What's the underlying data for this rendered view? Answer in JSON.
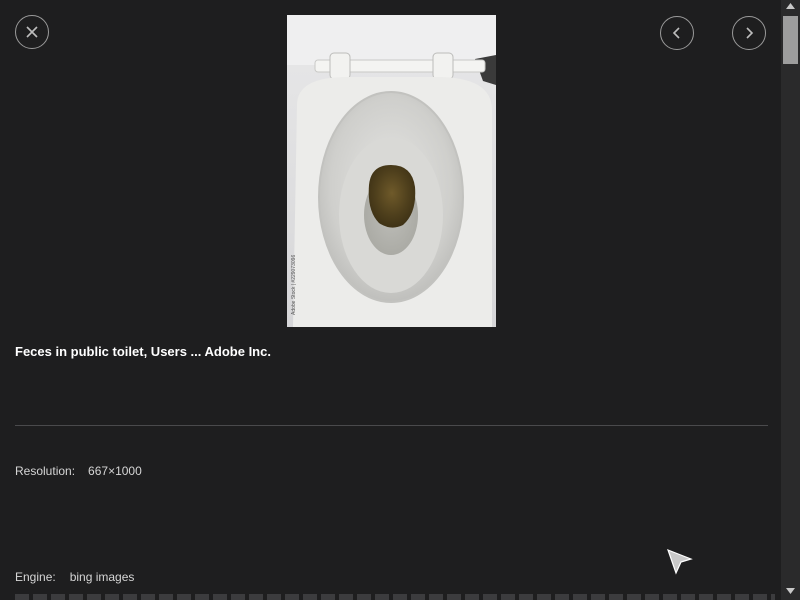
{
  "viewer": {
    "title": "Feces in public toilet, Users ... Adobe Inc.",
    "resolution_label": "Resolution:",
    "resolution_value": "667×1000",
    "engine_label": "Engine:",
    "engine_value": "bing images"
  },
  "image": {
    "alt": "toilet bowl viewed from above",
    "watermark": "Adobe Stock | #229073096"
  },
  "icons": {
    "close": "close-icon",
    "prev": "chevron-left-icon",
    "next": "chevron-right-icon",
    "cursor": "mouse-cursor-icon"
  },
  "colors": {
    "background": "#1e1e1f",
    "title_text": "#ffffff",
    "meta_text": "#d6d6d6",
    "button_border": "#9a9a9a"
  }
}
